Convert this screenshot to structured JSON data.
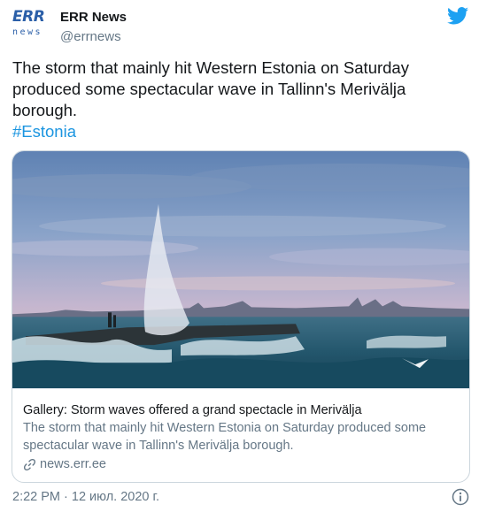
{
  "author": {
    "logo_text": "ERR",
    "logo_sub": "news",
    "name": "ERR News",
    "handle": "@errnews"
  },
  "tweet": {
    "text": "The storm that mainly hit Western Estonia on Saturday produced some spectacular wave in Tallinn's Merivälja borough.",
    "hashtag": "#Estonia"
  },
  "card": {
    "title": "Gallery: Storm waves offered a grand spectacle in Merivälja",
    "description": "The storm that mainly hit Western Estonia on Saturday produced some spectacular wave in Tallinn's Merivälja borough.",
    "domain": "news.err.ee"
  },
  "footer": {
    "timestamp": "2:22 PM · 12 июл. 2020 г."
  },
  "colors": {
    "brand": "#1da1f2",
    "hashtag": "#1b95e0",
    "secondary_text": "#657786",
    "err_blue": "#2b5fa8"
  },
  "icons": {
    "platform": "twitter-bird-icon",
    "link": "link-icon",
    "info": "info-icon"
  }
}
